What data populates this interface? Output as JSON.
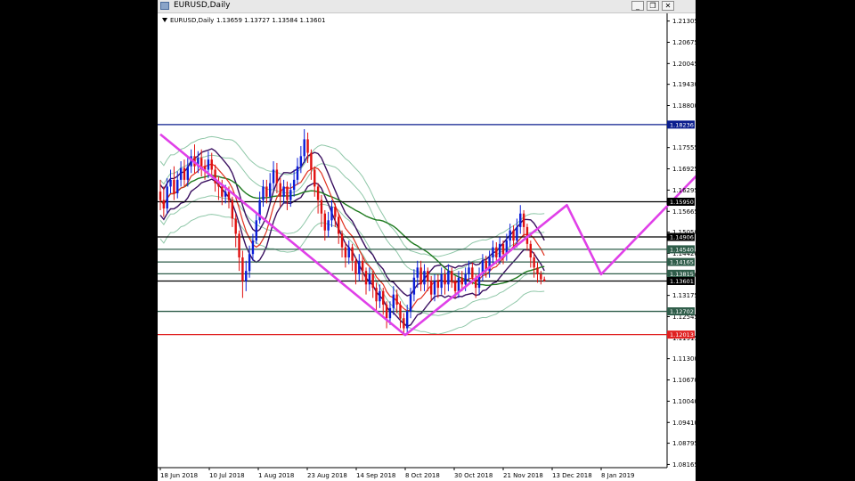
{
  "window": {
    "title": "EURUSD,Daily",
    "buttons": {
      "minimize": "_",
      "restore": "❐",
      "close": "✕"
    }
  },
  "chart_data": {
    "type": "candlestick",
    "symbol_label": "EURUSD,Daily",
    "ohlc_readout": "1.13659 1.13727 1.13584 1.13601",
    "ylim": [
      1.0815,
      1.214
    ],
    "y_ticks": [
      "1.21305",
      "1.20675",
      "1.20045",
      "1.19430",
      "1.18800",
      "1.17555",
      "1.16925",
      "1.16295",
      "1.15665",
      "1.15050",
      "1.14420",
      "1.13790",
      "1.13175",
      "1.12545",
      "1.11915",
      "1.11300",
      "1.10670",
      "1.10040",
      "1.09410",
      "1.08795",
      "1.08165"
    ],
    "x_ticks": [
      "18 Jun 2018",
      "10 Jul 2018",
      "1 Aug 2018",
      "23 Aug 2018",
      "14 Sep 2018",
      "8 Oct 2018",
      "30 Oct 2018",
      "21 Nov 2018",
      "13 Dec 2018",
      "8 Jan 2019"
    ],
    "horizontal_levels": [
      {
        "label": "1.18236",
        "value": 1.18236,
        "color": "#0b1e8e",
        "tag_bg": "#0b1e8e"
      },
      {
        "label": "1.15950",
        "value": 1.1595,
        "color": "#000000",
        "tag_bg": "#000000"
      },
      {
        "label": "1.14906",
        "value": 1.14906,
        "color": "#000000",
        "tag_bg": "#000000"
      },
      {
        "label": "1.14540",
        "value": 1.1454,
        "color": "#2f5d4a",
        "tag_bg": "#2f5d4a"
      },
      {
        "label": "1.14165",
        "value": 1.14165,
        "color": "#2f5d4a",
        "tag_bg": "#2f5d4a"
      },
      {
        "label": "1.13815",
        "value": 1.13815,
        "color": "#2f5d4a",
        "tag_bg": "#2f5d4a"
      },
      {
        "label": "1.13601",
        "value": 1.13601,
        "color": "#000000",
        "tag_bg": "#000000"
      },
      {
        "label": "1.12702",
        "value": 1.12702,
        "color": "#2f5d4a",
        "tag_bg": "#2f5d4a"
      },
      {
        "label": "1.12013",
        "value": 1.12013,
        "color": "#e02020",
        "tag_bg": "#e02020"
      }
    ],
    "pattern_path": [
      [
        0,
        1.1795
      ],
      [
        5,
        1.12
      ],
      [
        8.3,
        1.1585
      ],
      [
        9,
        1.138
      ],
      [
        11.3,
        1.1725
      ]
    ],
    "candles": [
      [
        0.0,
        1.1625,
        1.16,
        1.166,
        1.157
      ],
      [
        0.07,
        1.16,
        1.1575,
        1.164,
        1.155
      ],
      [
        0.14,
        1.1575,
        1.164,
        1.1665,
        1.156
      ],
      [
        0.21,
        1.164,
        1.166,
        1.169,
        1.162
      ],
      [
        0.28,
        1.166,
        1.162,
        1.17,
        1.16
      ],
      [
        0.35,
        1.162,
        1.166,
        1.1685,
        1.1605
      ],
      [
        0.42,
        1.166,
        1.1695,
        1.1715,
        1.164
      ],
      [
        0.49,
        1.1695,
        1.166,
        1.172,
        1.164
      ],
      [
        0.56,
        1.166,
        1.17,
        1.173,
        1.164
      ],
      [
        0.63,
        1.17,
        1.173,
        1.175,
        1.168
      ],
      [
        0.7,
        1.173,
        1.17,
        1.1765,
        1.168
      ],
      [
        0.77,
        1.17,
        1.1725,
        1.1745,
        1.168
      ],
      [
        0.84,
        1.1725,
        1.17,
        1.175,
        1.167
      ],
      [
        0.91,
        1.17,
        1.169,
        1.172,
        1.166
      ],
      [
        0.98,
        1.169,
        1.172,
        1.1745,
        1.1665
      ],
      [
        1.05,
        1.172,
        1.169,
        1.174,
        1.167
      ],
      [
        1.12,
        1.169,
        1.165,
        1.1705,
        1.1625
      ],
      [
        1.19,
        1.165,
        1.164,
        1.167,
        1.16
      ],
      [
        1.26,
        1.164,
        1.161,
        1.166,
        1.1585
      ],
      [
        1.33,
        1.161,
        1.1625,
        1.1645,
        1.159
      ],
      [
        1.4,
        1.1625,
        1.16,
        1.164,
        1.1575
      ],
      [
        1.47,
        1.16,
        1.1545,
        1.161,
        1.152
      ],
      [
        1.54,
        1.1545,
        1.15,
        1.156,
        1.146
      ],
      [
        1.61,
        1.15,
        1.143,
        1.151,
        1.139
      ],
      [
        1.68,
        1.143,
        1.136,
        1.145,
        1.131
      ],
      [
        1.75,
        1.136,
        1.139,
        1.142,
        1.133
      ],
      [
        1.82,
        1.139,
        1.144,
        1.1465,
        1.137
      ],
      [
        1.89,
        1.144,
        1.148,
        1.15,
        1.142
      ],
      [
        1.96,
        1.148,
        1.154,
        1.156,
        1.147
      ],
      [
        2.03,
        1.154,
        1.16,
        1.1625,
        1.153
      ],
      [
        2.1,
        1.16,
        1.164,
        1.166,
        1.158
      ],
      [
        2.17,
        1.164,
        1.161,
        1.166,
        1.159
      ],
      [
        2.24,
        1.161,
        1.165,
        1.168,
        1.1595
      ],
      [
        2.31,
        1.165,
        1.169,
        1.1715,
        1.163
      ],
      [
        2.38,
        1.169,
        1.165,
        1.171,
        1.162
      ],
      [
        2.45,
        1.165,
        1.161,
        1.1665,
        1.158
      ],
      [
        2.52,
        1.161,
        1.164,
        1.166,
        1.159
      ],
      [
        2.59,
        1.164,
        1.16,
        1.1655,
        1.157
      ],
      [
        2.66,
        1.16,
        1.163,
        1.165,
        1.158
      ],
      [
        2.73,
        1.163,
        1.166,
        1.169,
        1.161
      ],
      [
        2.8,
        1.166,
        1.17,
        1.1725,
        1.1645
      ],
      [
        2.87,
        1.17,
        1.173,
        1.176,
        1.168
      ],
      [
        2.94,
        1.173,
        1.178,
        1.181,
        1.171
      ],
      [
        3.01,
        1.178,
        1.174,
        1.18,
        1.171
      ],
      [
        3.08,
        1.174,
        1.169,
        1.175,
        1.166
      ],
      [
        3.15,
        1.169,
        1.164,
        1.17,
        1.161
      ],
      [
        3.22,
        1.164,
        1.16,
        1.165,
        1.156
      ],
      [
        3.29,
        1.16,
        1.156,
        1.1615,
        1.152
      ],
      [
        3.36,
        1.156,
        1.151,
        1.157,
        1.148
      ],
      [
        3.43,
        1.151,
        1.154,
        1.1565,
        1.149
      ],
      [
        3.5,
        1.154,
        1.158,
        1.16,
        1.152
      ],
      [
        3.57,
        1.158,
        1.155,
        1.159,
        1.152
      ],
      [
        3.64,
        1.155,
        1.15,
        1.156,
        1.147
      ],
      [
        3.71,
        1.15,
        1.146,
        1.151,
        1.143
      ],
      [
        3.78,
        1.146,
        1.143,
        1.1475,
        1.14
      ],
      [
        3.85,
        1.143,
        1.146,
        1.148,
        1.141
      ],
      [
        3.92,
        1.146,
        1.142,
        1.147,
        1.139
      ],
      [
        3.99,
        1.142,
        1.138,
        1.143,
        1.135
      ],
      [
        4.06,
        1.138,
        1.142,
        1.144,
        1.136
      ],
      [
        4.13,
        1.142,
        1.139,
        1.1435,
        1.136
      ],
      [
        4.2,
        1.139,
        1.135,
        1.14,
        1.132
      ],
      [
        4.27,
        1.135,
        1.138,
        1.14,
        1.133
      ],
      [
        4.34,
        1.138,
        1.134,
        1.139,
        1.131
      ],
      [
        4.41,
        1.134,
        1.13,
        1.1355,
        1.127
      ],
      [
        4.48,
        1.13,
        1.133,
        1.135,
        1.128
      ],
      [
        4.55,
        1.133,
        1.129,
        1.134,
        1.126
      ],
      [
        4.62,
        1.129,
        1.125,
        1.13,
        1.122
      ],
      [
        4.69,
        1.125,
        1.128,
        1.13,
        1.123
      ],
      [
        4.76,
        1.128,
        1.132,
        1.1345,
        1.126
      ],
      [
        4.83,
        1.132,
        1.129,
        1.1335,
        1.1265
      ],
      [
        4.9,
        1.129,
        1.125,
        1.13,
        1.122
      ],
      [
        4.97,
        1.125,
        1.122,
        1.1265,
        1.12
      ],
      [
        5.04,
        1.122,
        1.127,
        1.129,
        1.1205
      ],
      [
        5.11,
        1.127,
        1.132,
        1.134,
        1.125
      ],
      [
        5.18,
        1.132,
        1.137,
        1.1395,
        1.13
      ],
      [
        5.25,
        1.137,
        1.14,
        1.142,
        1.134
      ],
      [
        5.32,
        1.14,
        1.135,
        1.142,
        1.133
      ],
      [
        5.39,
        1.135,
        1.139,
        1.141,
        1.133
      ],
      [
        5.46,
        1.139,
        1.136,
        1.14,
        1.133
      ],
      [
        5.53,
        1.136,
        1.132,
        1.1375,
        1.13
      ],
      [
        5.6,
        1.132,
        1.136,
        1.138,
        1.13
      ],
      [
        5.67,
        1.136,
        1.134,
        1.138,
        1.131
      ],
      [
        5.74,
        1.134,
        1.138,
        1.14,
        1.132
      ],
      [
        5.81,
        1.138,
        1.135,
        1.1395,
        1.132
      ],
      [
        5.88,
        1.135,
        1.139,
        1.141,
        1.133
      ],
      [
        5.95,
        1.139,
        1.136,
        1.14,
        1.134
      ],
      [
        6.02,
        1.136,
        1.133,
        1.1375,
        1.131
      ],
      [
        6.09,
        1.133,
        1.137,
        1.139,
        1.131
      ],
      [
        6.16,
        1.137,
        1.135,
        1.139,
        1.133
      ],
      [
        6.23,
        1.135,
        1.138,
        1.14,
        1.133
      ],
      [
        6.3,
        1.138,
        1.14,
        1.142,
        1.136
      ],
      [
        6.37,
        1.14,
        1.137,
        1.1415,
        1.135
      ],
      [
        6.44,
        1.137,
        1.134,
        1.138,
        1.131
      ],
      [
        6.51,
        1.134,
        1.138,
        1.14,
        1.132
      ],
      [
        6.58,
        1.138,
        1.142,
        1.144,
        1.136
      ],
      [
        6.65,
        1.142,
        1.139,
        1.1435,
        1.137
      ],
      [
        6.72,
        1.139,
        1.143,
        1.145,
        1.137
      ],
      [
        6.79,
        1.143,
        1.146,
        1.148,
        1.141
      ],
      [
        6.86,
        1.146,
        1.143,
        1.1475,
        1.141
      ],
      [
        6.93,
        1.143,
        1.147,
        1.149,
        1.141
      ],
      [
        7.0,
        1.147,
        1.144,
        1.148,
        1.141
      ],
      [
        7.07,
        1.144,
        1.148,
        1.15,
        1.142
      ],
      [
        7.14,
        1.148,
        1.151,
        1.153,
        1.146
      ],
      [
        7.21,
        1.151,
        1.148,
        1.1525,
        1.146
      ],
      [
        7.28,
        1.148,
        1.152,
        1.1545,
        1.146
      ],
      [
        7.35,
        1.152,
        1.156,
        1.1585,
        1.15
      ],
      [
        7.42,
        1.156,
        1.152,
        1.157,
        1.149
      ],
      [
        7.49,
        1.152,
        1.147,
        1.153,
        1.145
      ],
      [
        7.56,
        1.147,
        1.143,
        1.148,
        1.14
      ],
      [
        7.63,
        1.143,
        1.14,
        1.1445,
        1.137
      ],
      [
        7.7,
        1.14,
        1.138,
        1.1415,
        1.1355
      ],
      [
        7.77,
        1.138,
        1.1365,
        1.139,
        1.135
      ],
      [
        7.84,
        1.1365,
        1.136,
        1.1373,
        1.1358
      ]
    ]
  }
}
